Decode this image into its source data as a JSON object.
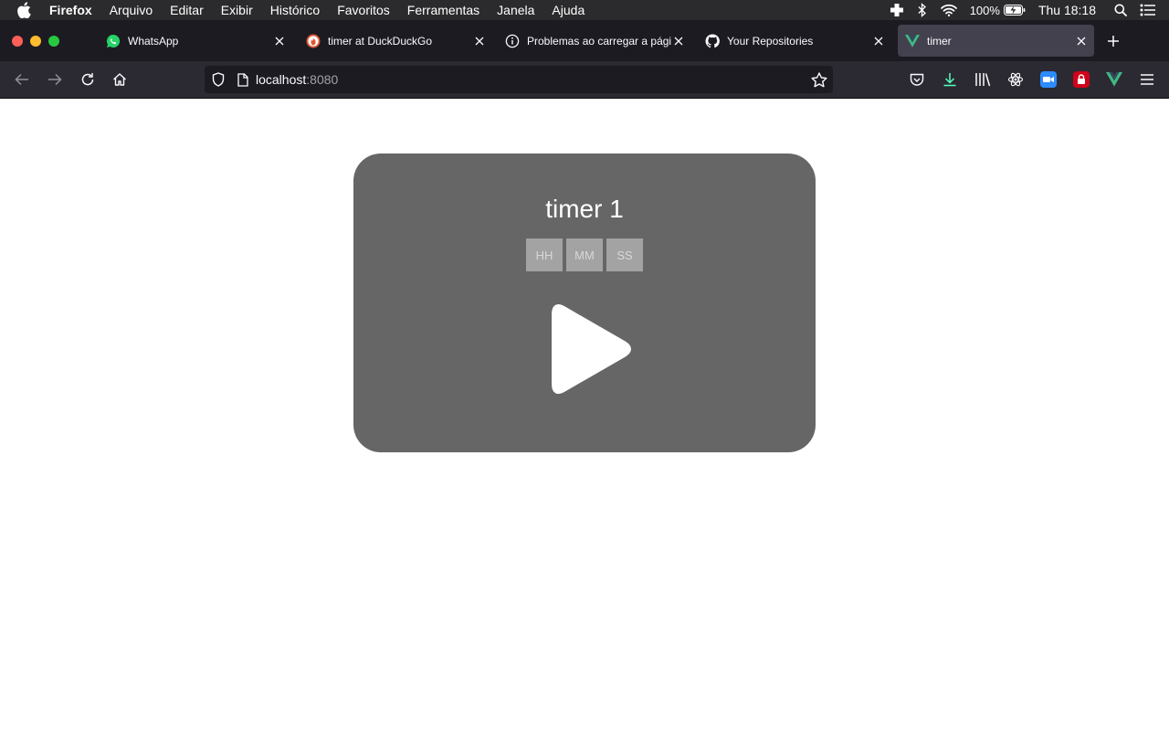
{
  "menubar": {
    "app_name": "Firefox",
    "items": [
      "Arquivo",
      "Editar",
      "Exibir",
      "Histórico",
      "Favoritos",
      "Ferramentas",
      "Janela",
      "Ajuda"
    ],
    "battery": "100%",
    "clock": "Thu 18:18"
  },
  "tabs": [
    {
      "title": "WhatsApp",
      "icon": "whatsapp-icon",
      "active": false
    },
    {
      "title": "timer at DuckDuckGo",
      "icon": "duckduckgo-icon",
      "active": false
    },
    {
      "title": "Problemas ao carregar a página",
      "icon": "info-icon",
      "active": false
    },
    {
      "title": "Your Repositories",
      "icon": "github-icon",
      "active": false
    },
    {
      "title": "timer",
      "icon": "vue-icon",
      "active": true
    }
  ],
  "urlbar": {
    "host": "localhost",
    "port": ":8080"
  },
  "timer": {
    "title": "timer 1",
    "hours_placeholder": "HH",
    "minutes_placeholder": "MM",
    "seconds_placeholder": "SS"
  },
  "colors": {
    "card": "#666666",
    "input": "#a3a3a3",
    "active_tab": "#42414d",
    "vue_green": "#41b883"
  }
}
